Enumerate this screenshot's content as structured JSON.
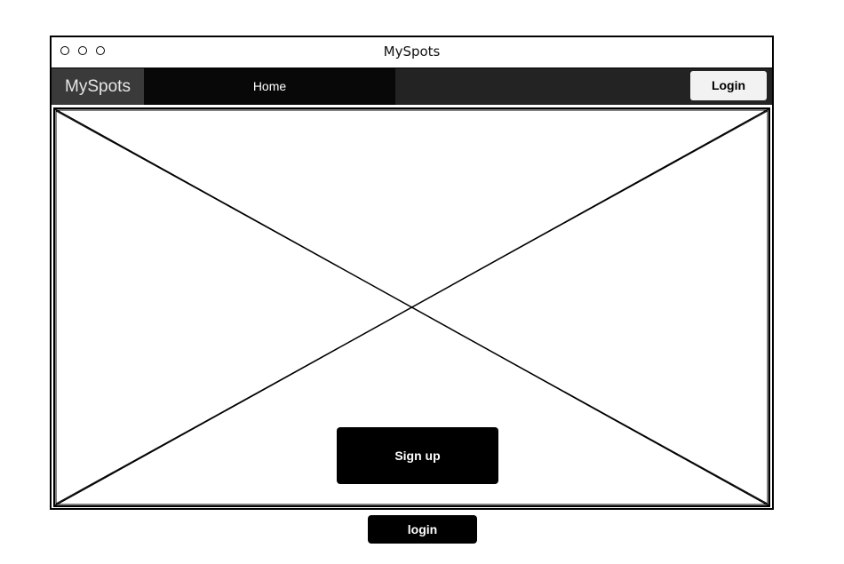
{
  "window": {
    "title": "MySpots"
  },
  "navbar": {
    "brand": "MySpots",
    "home_label": "Home",
    "login_label": "Login"
  },
  "hero": {
    "image_placeholder": "image-placeholder",
    "signup_label": "Sign up",
    "login_label": "login"
  },
  "colors": {
    "navbar_bg": "#232323",
    "brand_bg": "#3a3a3a",
    "home_bg": "#080808",
    "button_bg": "#000000",
    "nav_login_bg": "#f2f2f2"
  }
}
